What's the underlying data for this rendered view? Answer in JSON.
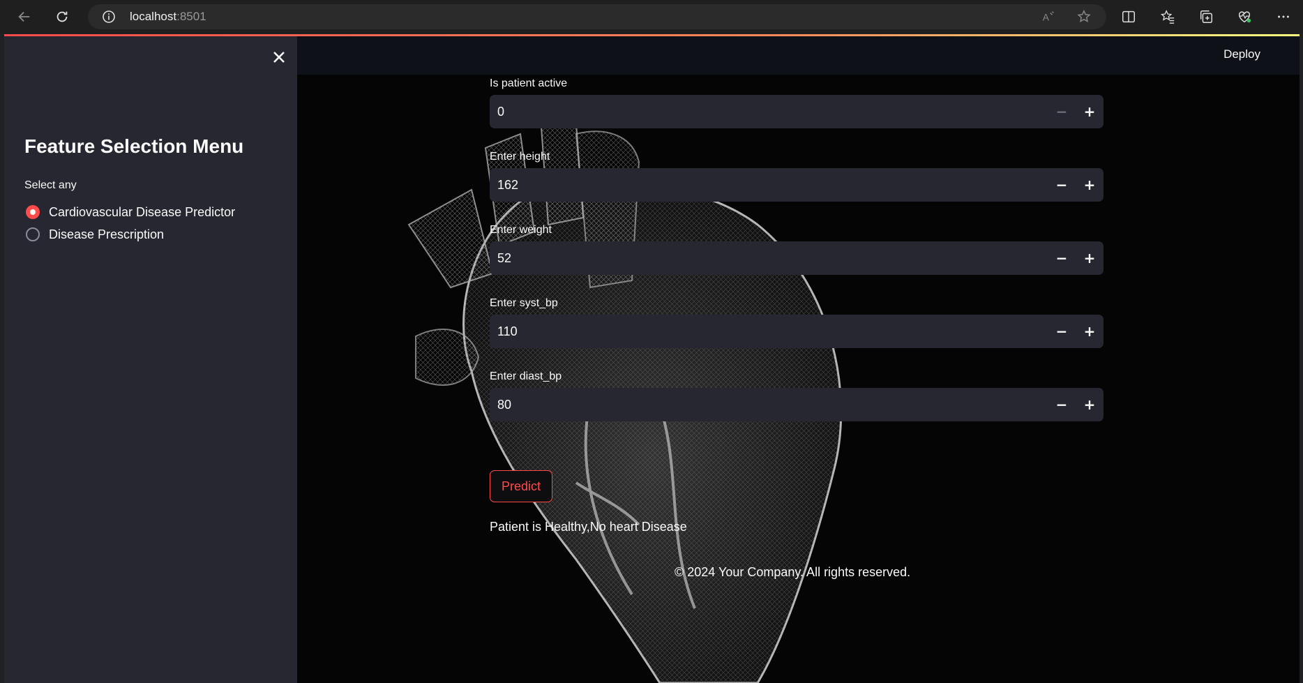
{
  "browser": {
    "url_host": "localhost",
    "url_port": ":8501"
  },
  "sidebar": {
    "title": "Feature Selection Menu",
    "select_label": "Select any",
    "options": [
      {
        "label": "Cardiovascular Disease Predictor",
        "selected": true
      },
      {
        "label": "Disease Prescription",
        "selected": false
      }
    ]
  },
  "header": {
    "deploy_label": "Deploy"
  },
  "form": {
    "fields": [
      {
        "label": "Is patient active",
        "value": "0"
      },
      {
        "label": "Enter height",
        "value": "162"
      },
      {
        "label": "Enter weight",
        "value": "52"
      },
      {
        "label": "Enter syst_bp",
        "value": "110"
      },
      {
        "label": "Enter diast_bp",
        "value": "80"
      }
    ],
    "stepper_minus": "−",
    "stepper_plus": "+",
    "predict_label": "Predict",
    "result_text": "Patient is Healthy,No heart Disease"
  },
  "footer": {
    "text": "© 2024 Your Company. All rights reserved."
  },
  "colors": {
    "accent": "#ff4b4b",
    "sidebar_bg": "#262730",
    "input_bg": "#262730",
    "header_bg": "#0e1117"
  }
}
